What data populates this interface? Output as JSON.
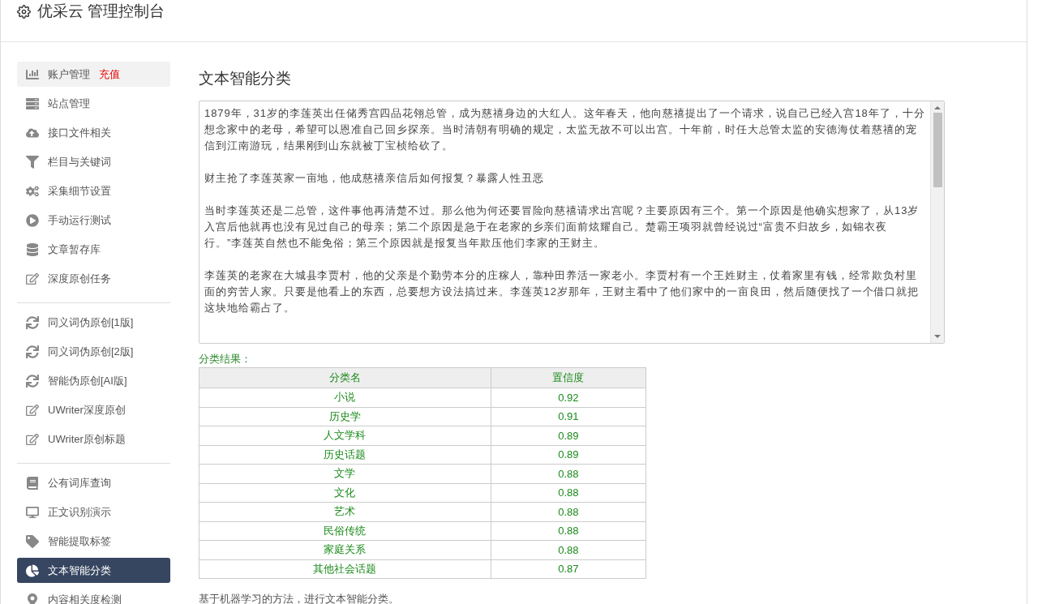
{
  "header": {
    "title": "优采云 管理控制台"
  },
  "sidebar": {
    "groups": [
      {
        "items": [
          {
            "kind": "chart",
            "label": "账户管理",
            "badge": "充值",
            "selected": false,
            "highlighted": true
          },
          {
            "kind": "server",
            "label": "站点管理",
            "selected": false,
            "highlighted": false
          },
          {
            "kind": "cloud",
            "label": "接口文件相关",
            "selected": false,
            "highlighted": false
          },
          {
            "kind": "filter",
            "label": "栏目与关键词",
            "selected": false,
            "highlighted": false
          },
          {
            "kind": "cogs",
            "label": "采集细节设置",
            "selected": false,
            "highlighted": false
          },
          {
            "kind": "play",
            "label": "手动运行测试",
            "selected": false,
            "highlighted": false
          },
          {
            "kind": "database",
            "label": "文章暂存库",
            "selected": false,
            "highlighted": false
          },
          {
            "kind": "edit",
            "label": "深度原创任务",
            "selected": false,
            "highlighted": false
          }
        ]
      },
      {
        "items": [
          {
            "kind": "sync",
            "label": "同义词伪原创[1版]",
            "selected": false,
            "highlighted": false
          },
          {
            "kind": "sync",
            "label": "同义词伪原创[2版]",
            "selected": false,
            "highlighted": false
          },
          {
            "kind": "sync",
            "label": "智能伪原创[AI版]",
            "selected": false,
            "highlighted": false
          },
          {
            "kind": "edit",
            "label": "UWriter深度原创",
            "selected": false,
            "highlighted": false
          },
          {
            "kind": "edit",
            "label": "UWriter原创标题",
            "selected": false,
            "highlighted": false
          }
        ]
      },
      {
        "items": [
          {
            "kind": "book",
            "label": "公有词库查询",
            "selected": false,
            "highlighted": false
          },
          {
            "kind": "desktop",
            "label": "正文识别演示",
            "selected": false,
            "highlighted": false
          },
          {
            "kind": "tag",
            "label": "智能提取标签",
            "selected": false,
            "highlighted": false
          },
          {
            "kind": "pie",
            "label": "文本智能分类",
            "selected": true,
            "highlighted": false
          },
          {
            "kind": "marker",
            "label": "内容相关度检测",
            "selected": false,
            "highlighted": false
          }
        ]
      }
    ]
  },
  "main": {
    "title": "文本智能分类",
    "input_text": [
      "1879年，31岁的李莲英出任储秀宫四品花翎总管，成为慈禧身边的大红人。这年春天，他向慈禧提出了一个请求，说自己已经入宫18年了，十分想念家中的老母，希望可以恩准自己回乡探亲。当时清朝有明确的规定，太监无故不可以出宫。十年前，时任大总管太监的安德海仗着慈禧的宠信到江南游玩，结果刚到山东就被丁宝桢给砍了。",
      "财主抢了李莲英家一亩地，他成慈禧亲信后如何报复？暴露人性丑恶",
      "当时李莲英还是二总管，这件事他再清楚不过。那么他为何还要冒险向慈禧请求出宫呢？主要原因有三个。第一个原因是他确实想家了，从13岁入宫后他就再也没有见过自己的母亲；第二个原因是急于在老家的乡亲们面前炫耀自己。楚霸王项羽就曾经说过“富贵不归故乡，如锦衣夜行。”李莲英自然也不能免俗；第三个原因就是报复当年欺压他们李家的王财主。",
      "李莲英的老家在大城县李贾村，他的父亲是个勤劳本分的庄稼人，靠种田养活一家老小。李贾村有一个王姓财主，仗着家里有钱，经常欺负村里面的穷苦人家。只要是他看上的东西，总要想方设法搞过来。李莲英12岁那年，王财主看中了他们家中的一亩良田，然后随便找了一个借口就把这块地给霸占了。"
    ],
    "result_label": "分类结果：",
    "table": {
      "columns": [
        "分类名",
        "置信度"
      ],
      "rows": [
        [
          "小说",
          "0.92"
        ],
        [
          "历史学",
          "0.91"
        ],
        [
          "人文学科",
          "0.89"
        ],
        [
          "历史话题",
          "0.89"
        ],
        [
          "文学",
          "0.88"
        ],
        [
          "文化",
          "0.88"
        ],
        [
          "艺术",
          "0.88"
        ],
        [
          "民俗传统",
          "0.88"
        ],
        [
          "家庭关系",
          "0.88"
        ],
        [
          "其他社会话题",
          "0.87"
        ]
      ]
    },
    "note": "基于机器学习的方法，进行文本智能分类。"
  }
}
